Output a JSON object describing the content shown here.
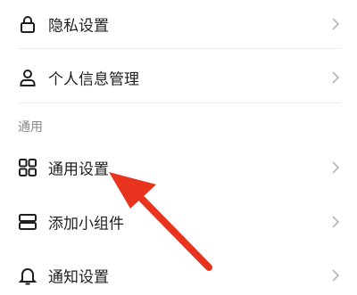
{
  "rows": [
    {
      "label": "隐私设置",
      "icon": "lock-icon"
    },
    {
      "label": "个人信息管理",
      "icon": "person-icon"
    }
  ],
  "section_general": {
    "header": "通用",
    "rows": [
      {
        "label": "通用设置",
        "icon": "grid-icon"
      },
      {
        "label": "添加小组件",
        "icon": "widget-icon"
      },
      {
        "label": "通知设置",
        "icon": "bell-icon"
      }
    ]
  },
  "colors": {
    "annotation_arrow": "#e8341f",
    "text": "#1f1f1f",
    "muted": "#8a8a8a",
    "chevron": "#b5b5b5"
  }
}
